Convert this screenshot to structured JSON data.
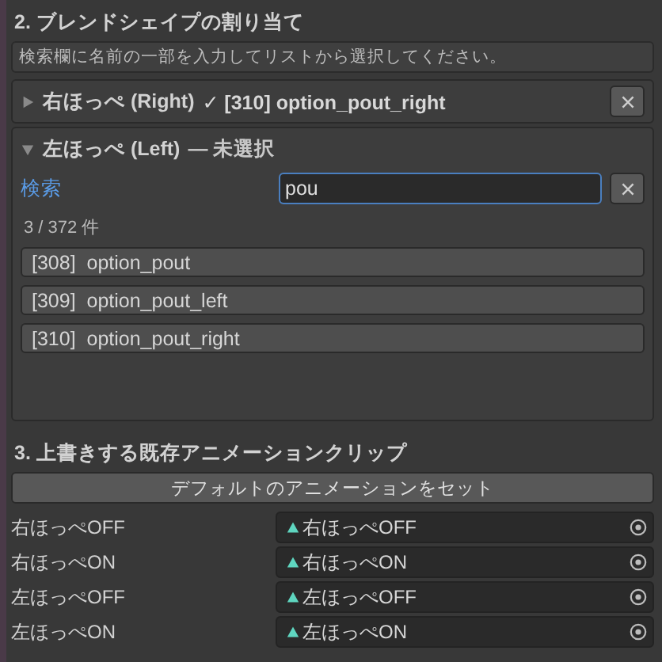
{
  "blend_section": {
    "title": "2. ブレンドシェイプの割り当て",
    "help": "検索欄に名前の一部を入力してリストから選択してください。",
    "slots": [
      {
        "label": "右ほっぺ (Right)",
        "status": "✓ [310] option_pout_right",
        "expanded": false
      },
      {
        "label": "左ほっぺ (Left)",
        "status": "— 未選択",
        "expanded": true,
        "search_label": "検索",
        "search_value": "pou",
        "count": "3 / 372 件",
        "results": [
          "[308]  option_pout",
          "[309]  option_pout_left",
          "[310]  option_pout_right"
        ]
      }
    ]
  },
  "clip_section": {
    "title": "3. 上書きする既存アニメーションクリップ",
    "button": "デフォルトのアニメーションをセット",
    "clips": [
      {
        "label": "右ほっぺOFF",
        "value": "右ほっぺOFF"
      },
      {
        "label": "右ほっぺON",
        "value": "右ほっぺON"
      },
      {
        "label": "左ほっぺOFF",
        "value": "左ほっぺOFF"
      },
      {
        "label": "左ほっぺON",
        "value": "左ほっぺON"
      }
    ]
  }
}
